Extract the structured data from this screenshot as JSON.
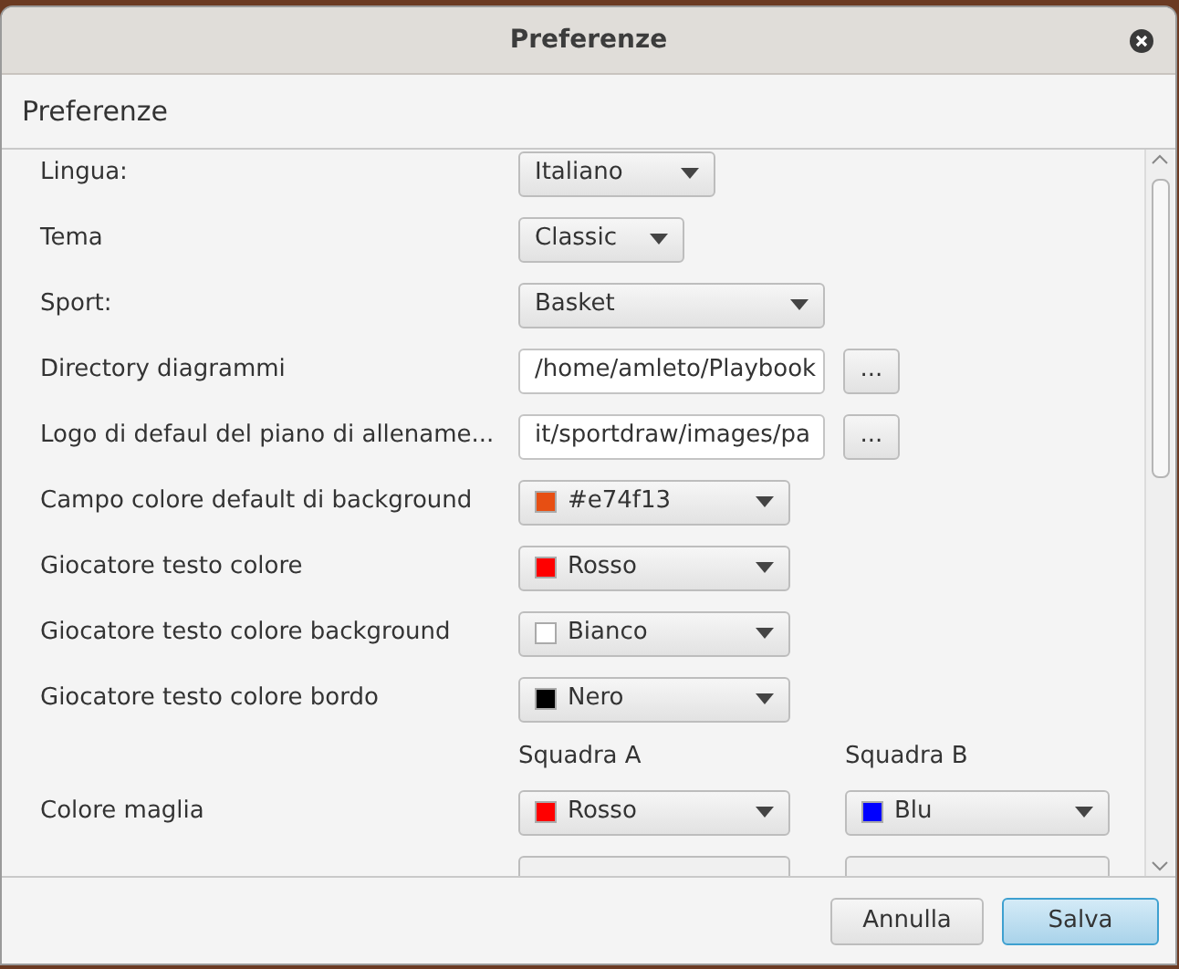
{
  "window": {
    "title": "Preferenze"
  },
  "header": "Preferenze",
  "rows": [
    {
      "kind": "combo",
      "label": "Lingua:",
      "value": "Italiano"
    },
    {
      "kind": "combo",
      "label": "Tema",
      "value": "Classic"
    },
    {
      "kind": "combo",
      "label": "Sport:",
      "value": "Basket"
    },
    {
      "kind": "path",
      "label": "Directory diagrammi",
      "value": "/home/amleto/Playbook",
      "button": "..."
    },
    {
      "kind": "path",
      "label": "Logo di defaul del piano di allename...",
      "value": "it/sportdraw/images/pa",
      "button": "..."
    },
    {
      "kind": "color",
      "label": "Campo colore default di background",
      "value": "#e74f13",
      "color": "#e74f13"
    },
    {
      "kind": "color",
      "label": "Giocatore testo colore",
      "value": "Rosso",
      "color": "#ff0000"
    },
    {
      "kind": "color",
      "label": "Giocatore testo colore background",
      "value": "Bianco",
      "color": "#ffffff"
    },
    {
      "kind": "color",
      "label": "Giocatore testo colore bordo",
      "value": "Nero",
      "color": "#000000"
    },
    {
      "kind": "teams",
      "team_a": "Squadra A",
      "team_b": "Squadra B"
    },
    {
      "kind": "team_color",
      "label": "Colore maglia",
      "team_a": {
        "value": "Rosso",
        "color": "#ff0000"
      },
      "team_b": {
        "value": "Blu",
        "color": "#0000ff"
      }
    }
  ],
  "buttons": [
    {
      "label": "Annulla",
      "default": false
    },
    {
      "label": "Salva",
      "default": true
    }
  ]
}
